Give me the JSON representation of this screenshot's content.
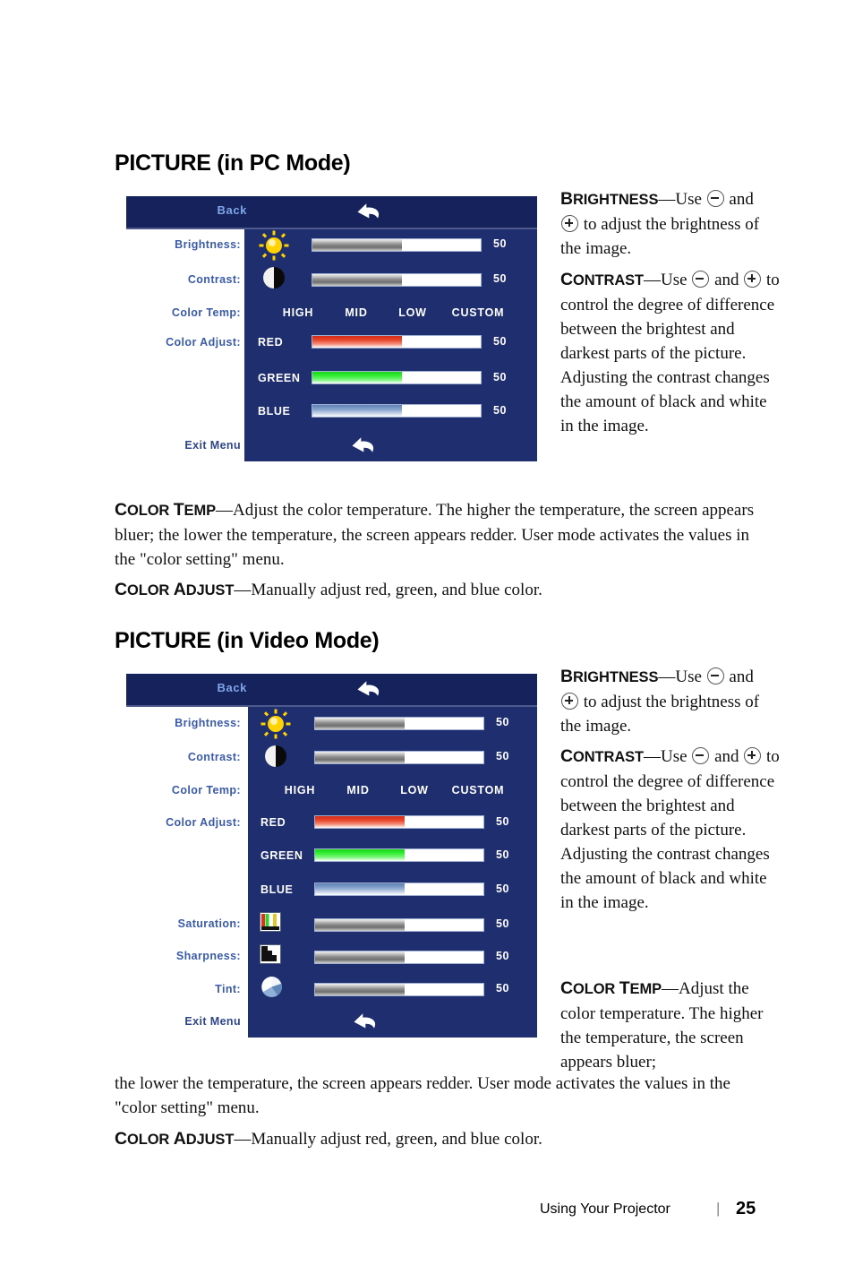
{
  "headings": {
    "pc": "PICTURE (in PC Mode)",
    "video": "PICTURE (in Video Mode)"
  },
  "osd_pc": {
    "back_label": "Back",
    "exit_label": "Exit Menu",
    "rows": [
      {
        "label": "Brightness:",
        "icon": "brightness-sun-icon",
        "value": "50",
        "fill": "grey"
      },
      {
        "label": "Contrast:",
        "icon": "contrast-halfmoon-icon",
        "value": "50",
        "fill": "grey"
      },
      {
        "label": "Color Temp:",
        "icon": "none",
        "value": "",
        "fill": "none"
      },
      {
        "label": "Color Adjust:",
        "icon": "none",
        "value": "",
        "fill": "none"
      }
    ],
    "color_temp_options": [
      "HIGH",
      "MID",
      "LOW",
      "CUSTOM"
    ],
    "color_channels": [
      {
        "name": "RED",
        "value": "50",
        "fill": "red"
      },
      {
        "name": "GREEN",
        "value": "50",
        "fill": "green"
      },
      {
        "name": "BLUE",
        "value": "50",
        "fill": "blue"
      }
    ]
  },
  "osd_video": {
    "back_label": "Back",
    "exit_label": "Exit Menu",
    "rows": [
      {
        "label": "Brightness:",
        "icon": "brightness-sun-icon",
        "value": "50",
        "fill": "grey"
      },
      {
        "label": "Contrast:",
        "icon": "contrast-halfmoon-icon",
        "value": "50",
        "fill": "grey"
      },
      {
        "label": "Color Temp:",
        "icon": "none",
        "value": "",
        "fill": "none"
      },
      {
        "label": "Color Adjust:",
        "icon": "none",
        "value": "",
        "fill": "none"
      },
      {
        "label": "Saturation:",
        "icon": "saturation-colorbars-icon",
        "value": "50",
        "fill": "grey"
      },
      {
        "label": "Sharpness:",
        "icon": "sharpness-icon",
        "value": "50",
        "fill": "grey"
      },
      {
        "label": "Tint:",
        "icon": "tint-pie-icon",
        "value": "50",
        "fill": "grey"
      }
    ],
    "color_temp_options": [
      "HIGH",
      "MID",
      "LOW",
      "CUSTOM"
    ],
    "color_channels": [
      {
        "name": "RED",
        "value": "50",
        "fill": "red"
      },
      {
        "name": "GREEN",
        "value": "50",
        "fill": "green"
      },
      {
        "name": "BLUE",
        "value": "50",
        "fill": "blue"
      }
    ]
  },
  "text": {
    "brightness_term": "BRIGHTNESS",
    "brightness_body_a": "—Use ",
    "brightness_body_b": " and ",
    "brightness_body_c": " to adjust the brightness of the image.",
    "contrast_term": "CONTRAST",
    "contrast_body_a": "—Use ",
    "contrast_body_b": " and ",
    "contrast_body_c": " to control the degree of difference between the brightest and darkest parts of the picture. Adjusting the contrast changes the amount of black and white in the image.",
    "colortemp_term": "COLOR TEMP",
    "colortemp_body_pc": "—Adjust the color temperature. The higher the temperature, the screen appears bluer; the lower the temperature, the screen appears redder. User mode activates the values in the \"color setting\" menu.",
    "colortemp_body_video_top": "—Adjust the color temperature. The higher the temperature, the screen appears bluer;",
    "colortemp_body_video_rest": "the lower the temperature, the screen appears redder. User mode activates the values in the \"color setting\" menu.",
    "coloradjust_term": "COLOR ADJUST",
    "coloradjust_body": "—Manually adjust red, green, and blue color."
  },
  "footer": {
    "label": "Using Your Projector",
    "separator": "|",
    "page": "25"
  },
  "colors": {
    "osd_header_bg": "#16225c",
    "osd_panel_bg": "#1f2e6e",
    "osd_label_blue": "#3b5ba8",
    "back_label_blue": "#7fa5e8"
  }
}
